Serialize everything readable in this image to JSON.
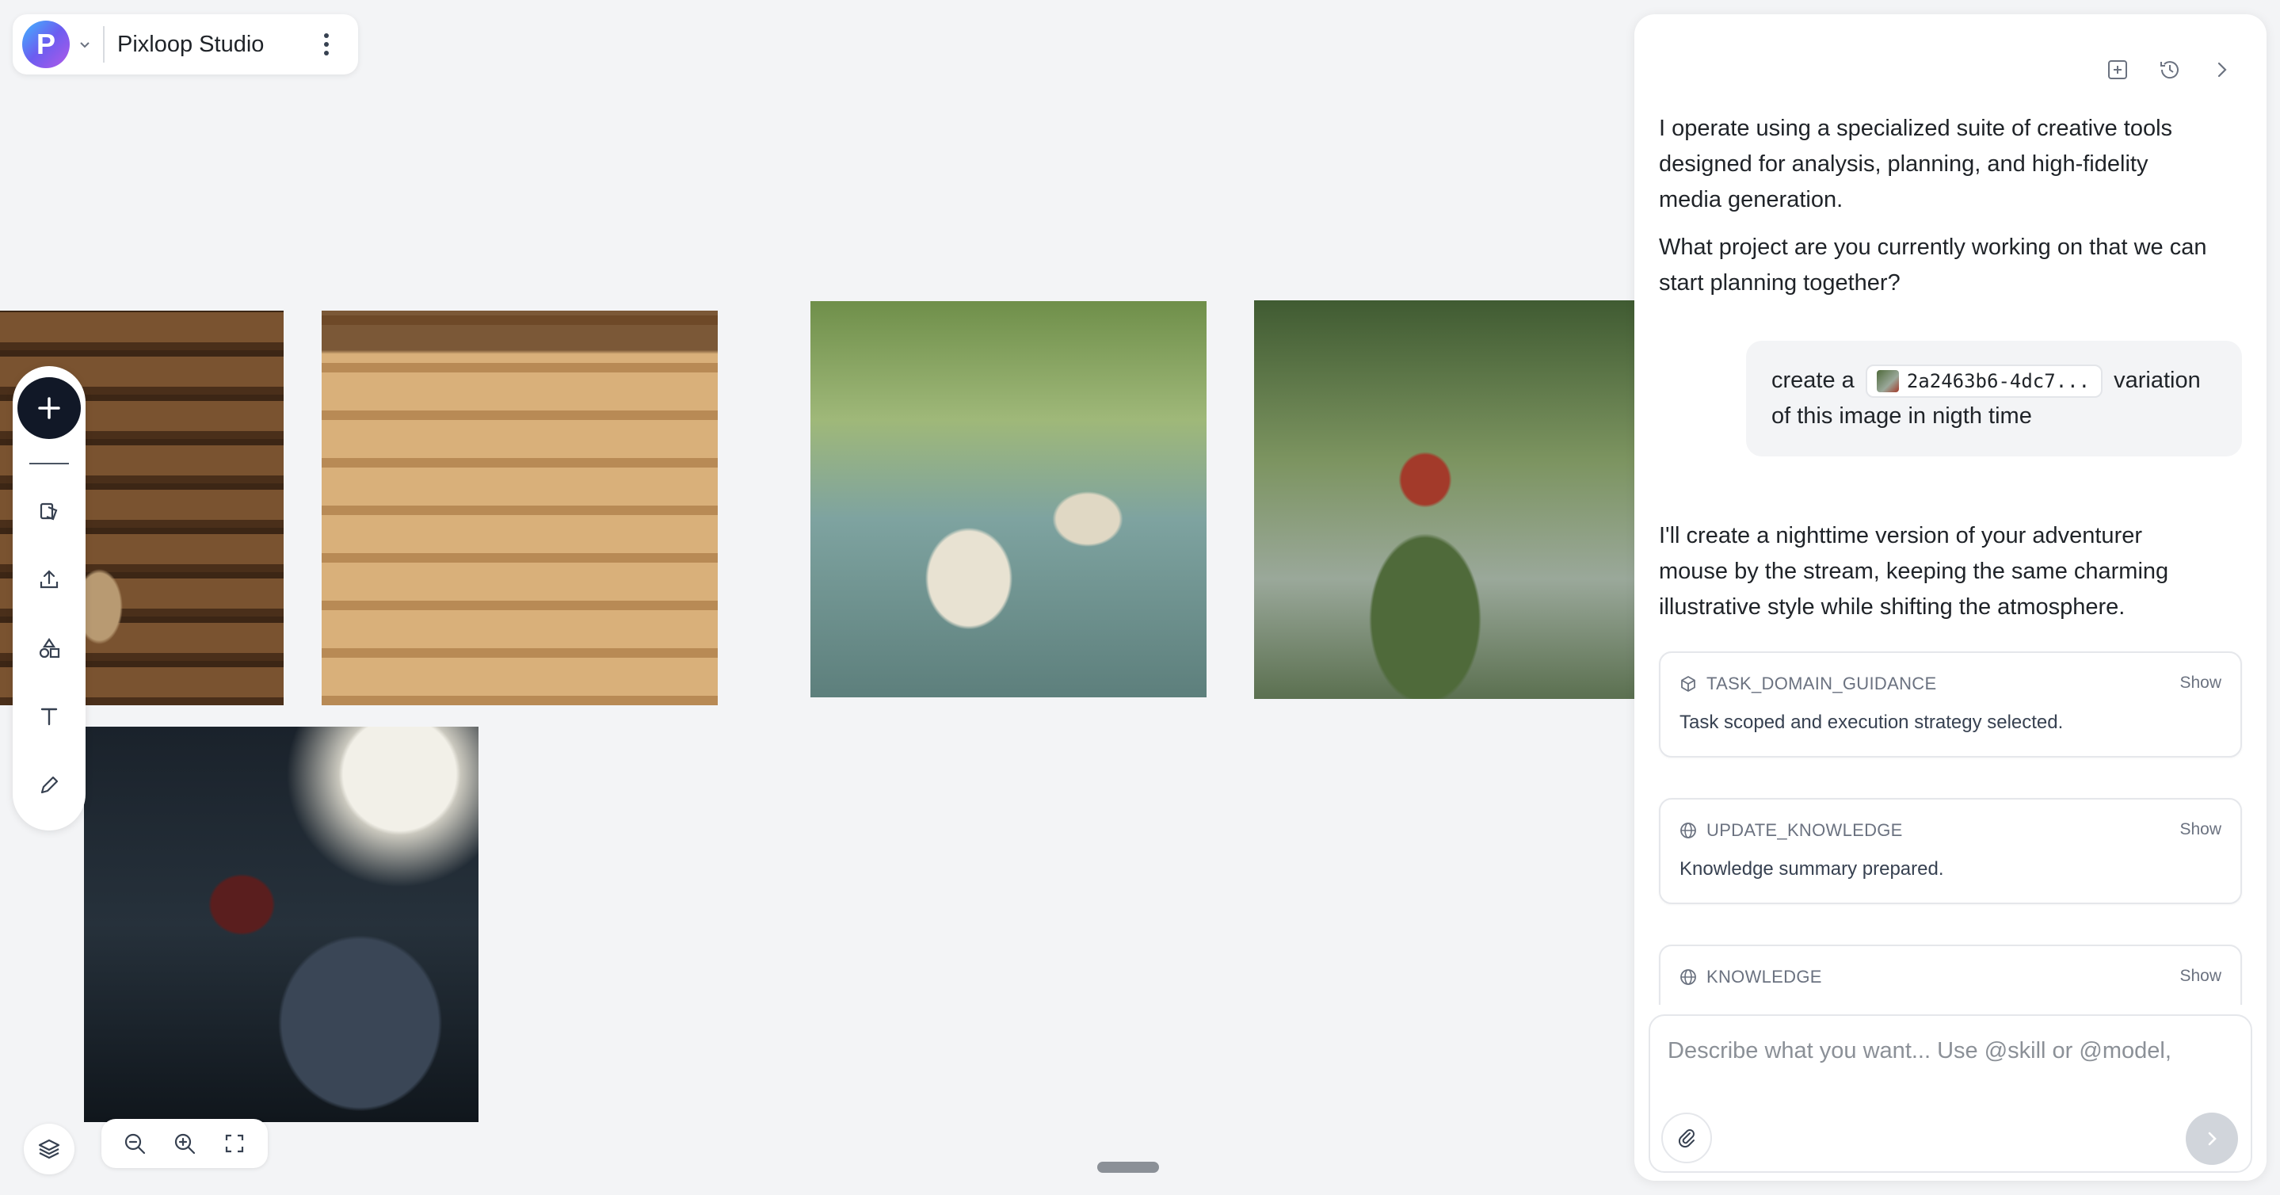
{
  "app": {
    "name": "Pixloop Studio",
    "logo_letter": "P"
  },
  "canvas": {
    "images": [
      {
        "name": "mouse-library-bookshelf"
      },
      {
        "name": "the-great-pantry-kingdom"
      },
      {
        "name": "mice-boats-forest-stream"
      },
      {
        "name": "adventurer-mouse-by-stream"
      },
      {
        "name": "adventurer-mouse-night-moon"
      }
    ]
  },
  "toolbar": {
    "tools": [
      "add-icon",
      "assets-icon",
      "upload-icon",
      "shapes-icon",
      "text-icon",
      "pen-icon"
    ]
  },
  "chat": {
    "messages": {
      "intro": "I operate using a specialized suite of creative tools designed for analysis, planning, and high-fidelity media generation.",
      "question": "What project are you currently working on that we can start planning together?",
      "user_prefix": "create a",
      "user_ref": "2a2463b6-4dc7...",
      "user_suffix": "variation of this image in nigth time",
      "reply": "I'll create a nighttime version of your adventurer mouse by the stream, keeping the same charming illustrative style while shifting the atmosphere."
    },
    "tasks": [
      {
        "title": "TASK_DOMAIN_GUIDANCE",
        "action": "Show",
        "detail": "Task scoped and execution strategy selected.",
        "icon": "cube-icon"
      },
      {
        "title": "UPDATE_KNOWLEDGE",
        "action": "Show",
        "detail": "Knowledge summary prepared.",
        "icon": "globe-icon"
      },
      {
        "title": "KNOWLEDGE",
        "action": "Show",
        "detail": "",
        "icon": "globe-icon"
      }
    ],
    "composer": {
      "placeholder": "Describe what you want... Use @skill or @model,"
    }
  },
  "colors": {
    "dark": "#111827",
    "panel_bg": "#ffffff",
    "canvas_bg": "#f3f4f6",
    "muted": "#6b7280"
  }
}
